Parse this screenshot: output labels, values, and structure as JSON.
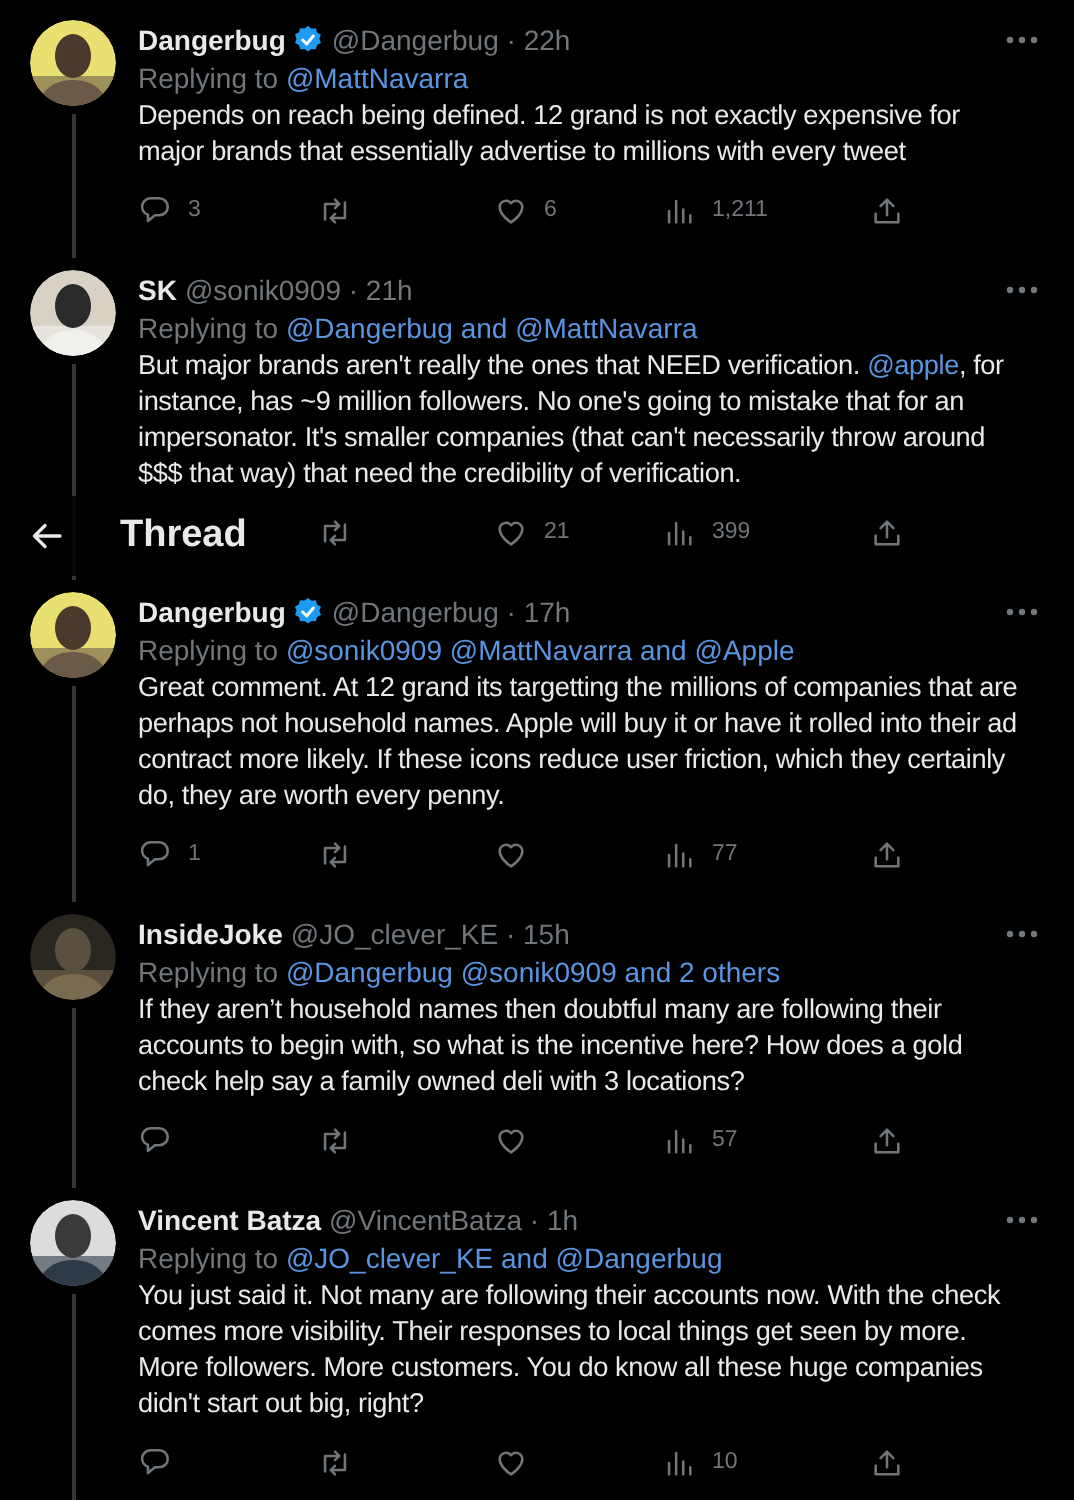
{
  "header": {
    "title": "Thread"
  },
  "tweets": [
    {
      "name": "Dangerbug",
      "verified": true,
      "handle": "@Dangerbug · 22h",
      "replying_label": "Replying to",
      "replying_to": "@MattNavarra",
      "body": [
        {
          "text": "Depends on reach being defined. 12 grand is not exactly expensive for major brands that essentially advertise to millions with every tweet"
        }
      ],
      "actions": [
        {
          "kind": "reply",
          "count": "3"
        },
        {
          "kind": "retweet"
        },
        {
          "kind": "like",
          "count": "6"
        },
        {
          "kind": "views",
          "count": "1,211"
        },
        {
          "kind": "share"
        }
      ]
    },
    {
      "name": "SK",
      "verified": false,
      "handle": "@sonik0909 · 21h",
      "replying_label": "Replying to",
      "replying_to": "@Dangerbug and @MattNavarra",
      "body": [
        {
          "text": "But major brands aren't really the ones that NEED verification. "
        },
        {
          "text": "@apple",
          "kind": "mention"
        },
        {
          "text": ", for instance, has ~9 million followers. No one's going to mistake that for an impersonator. It's smaller companies (that can't necessarily throw around $$$ that way) that need the credibility of verification."
        }
      ],
      "actions": [
        {
          "kind": "retweet"
        },
        {
          "kind": "like",
          "count": "21"
        },
        {
          "kind": "views",
          "count": "399"
        },
        {
          "kind": "share"
        }
      ]
    },
    {
      "name": "Dangerbug",
      "verified": true,
      "handle": "@Dangerbug · 17h",
      "replying_label": "Replying to",
      "replying_to": "@sonik0909 @MattNavarra and @Apple",
      "body": [
        {
          "text": "Great comment. At 12 grand its targetting the millions of companies that are perhaps not household names. Apple will buy it or have it rolled into their ad contract more likely. If these icons reduce user friction, which they certainly do,  they are worth every penny."
        }
      ],
      "actions": [
        {
          "kind": "reply",
          "count": "1"
        },
        {
          "kind": "retweet"
        },
        {
          "kind": "like"
        },
        {
          "kind": "views",
          "count": "77"
        },
        {
          "kind": "share"
        }
      ]
    },
    {
      "name": "InsideJoke",
      "verified": false,
      "handle": "@JO_clever_KE · 15h",
      "replying_label": "Replying to",
      "replying_to": "@Dangerbug @sonik0909 and 2 others",
      "body": [
        {
          "text": "If they aren’t household names then doubtful many are following their accounts to begin with, so what is the incentive here? How does a gold check help say a family owned deli with 3 locations?"
        }
      ],
      "actions": [
        {
          "kind": "reply"
        },
        {
          "kind": "retweet"
        },
        {
          "kind": "like"
        },
        {
          "kind": "views",
          "count": "57"
        },
        {
          "kind": "share"
        }
      ]
    },
    {
      "name": "Vincent Batza",
      "verified": false,
      "handle": "@VincentBatza · 1h",
      "replying_label": "Replying to",
      "replying_to": "@JO_clever_KE and @Dangerbug",
      "body": [
        {
          "text": "You just said it. Not many are following their accounts now. With the check comes more visibility. Their responses to local things get seen by more. More followers. More customers. You do know all these huge companies didn't start out big, right?"
        }
      ],
      "actions": [
        {
          "kind": "reply"
        },
        {
          "kind": "retweet"
        },
        {
          "kind": "like"
        },
        {
          "kind": "views",
          "count": "10"
        },
        {
          "kind": "share"
        }
      ]
    }
  ]
}
